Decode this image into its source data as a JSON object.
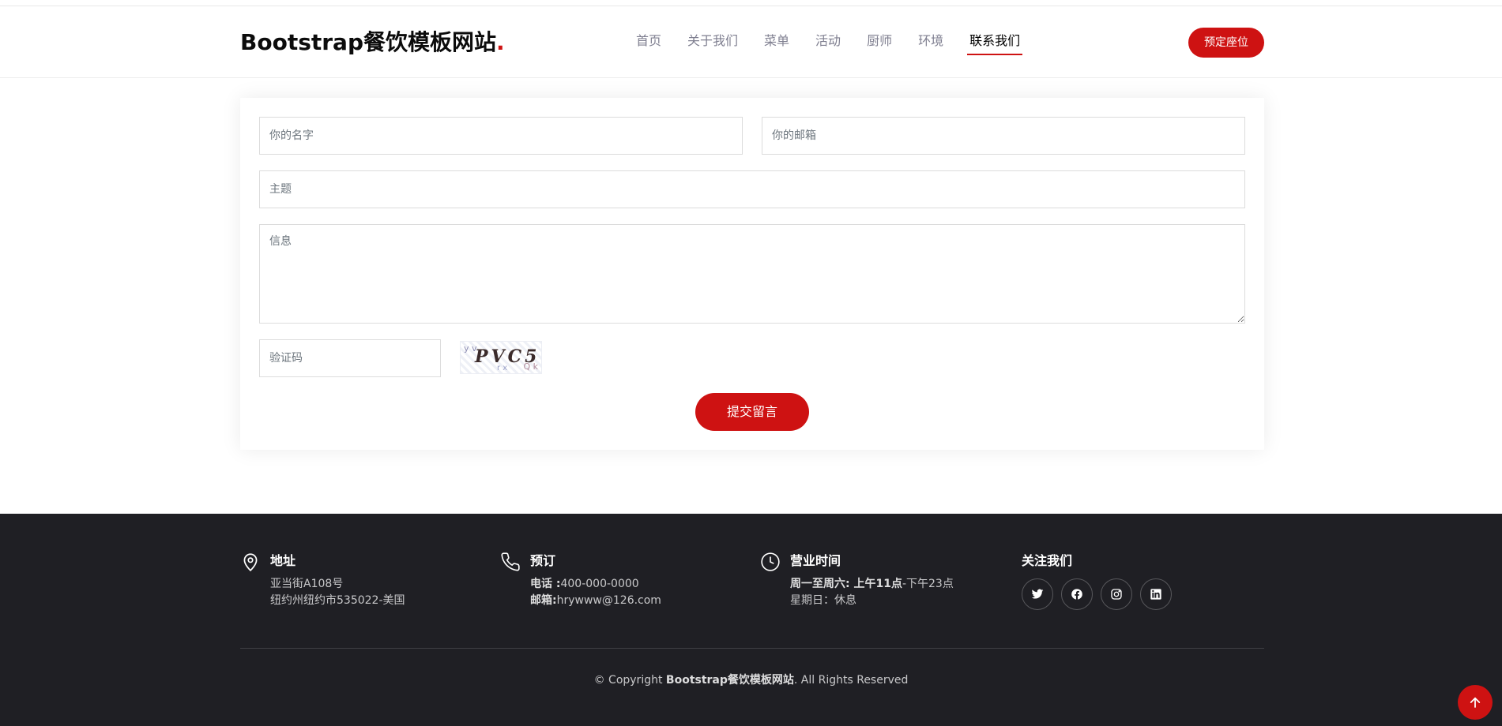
{
  "header": {
    "logo_text": "Bootstrap餐饮模板网站",
    "logo_dot": ".",
    "nav": [
      {
        "label": "首页"
      },
      {
        "label": "关于我们"
      },
      {
        "label": "菜单"
      },
      {
        "label": "活动"
      },
      {
        "label": "厨师"
      },
      {
        "label": "环境"
      },
      {
        "label": "联系我们"
      }
    ],
    "active_nav": "联系我们",
    "book_label": "预定座位"
  },
  "form": {
    "name_placeholder": "你的名字",
    "email_placeholder": "你的邮箱",
    "subject_placeholder": "主题",
    "message_placeholder": "信息",
    "captcha_placeholder": "验证码",
    "captcha_text": "PVC5",
    "submit_label": "提交留言"
  },
  "footer": {
    "address": {
      "title": "地址",
      "line1": "亚当街A108号",
      "line2": "纽约州纽约市535022-美国"
    },
    "booking": {
      "title": "预订",
      "phone_label": "电话 :",
      "phone_value": "400-000-0000",
      "email_label": "邮箱:",
      "email_value": "hrywww@126.com"
    },
    "hours": {
      "title": "营业时间",
      "weekday_label": "周一至周六:",
      "weekday_value_bold": " 上午11点",
      "weekday_value_rest": "-下午23点",
      "sunday": "星期日：休息"
    },
    "follow": {
      "title": "关注我们"
    },
    "copyright_prefix": "© Copyright ",
    "copyright_brand": "Bootstrap餐饮模板网站",
    "copyright_suffix": ". All Rights Reserved"
  },
  "colors": {
    "accent": "#ce1212",
    "footer_bg": "#1f1f24"
  },
  "icons": {
    "address": "map-pin-icon",
    "booking": "phone-icon",
    "hours": "clock-icon",
    "socials": [
      "twitter-icon",
      "facebook-icon",
      "instagram-icon",
      "linkedin-icon"
    ],
    "back_to_top": "arrow-up-icon"
  }
}
